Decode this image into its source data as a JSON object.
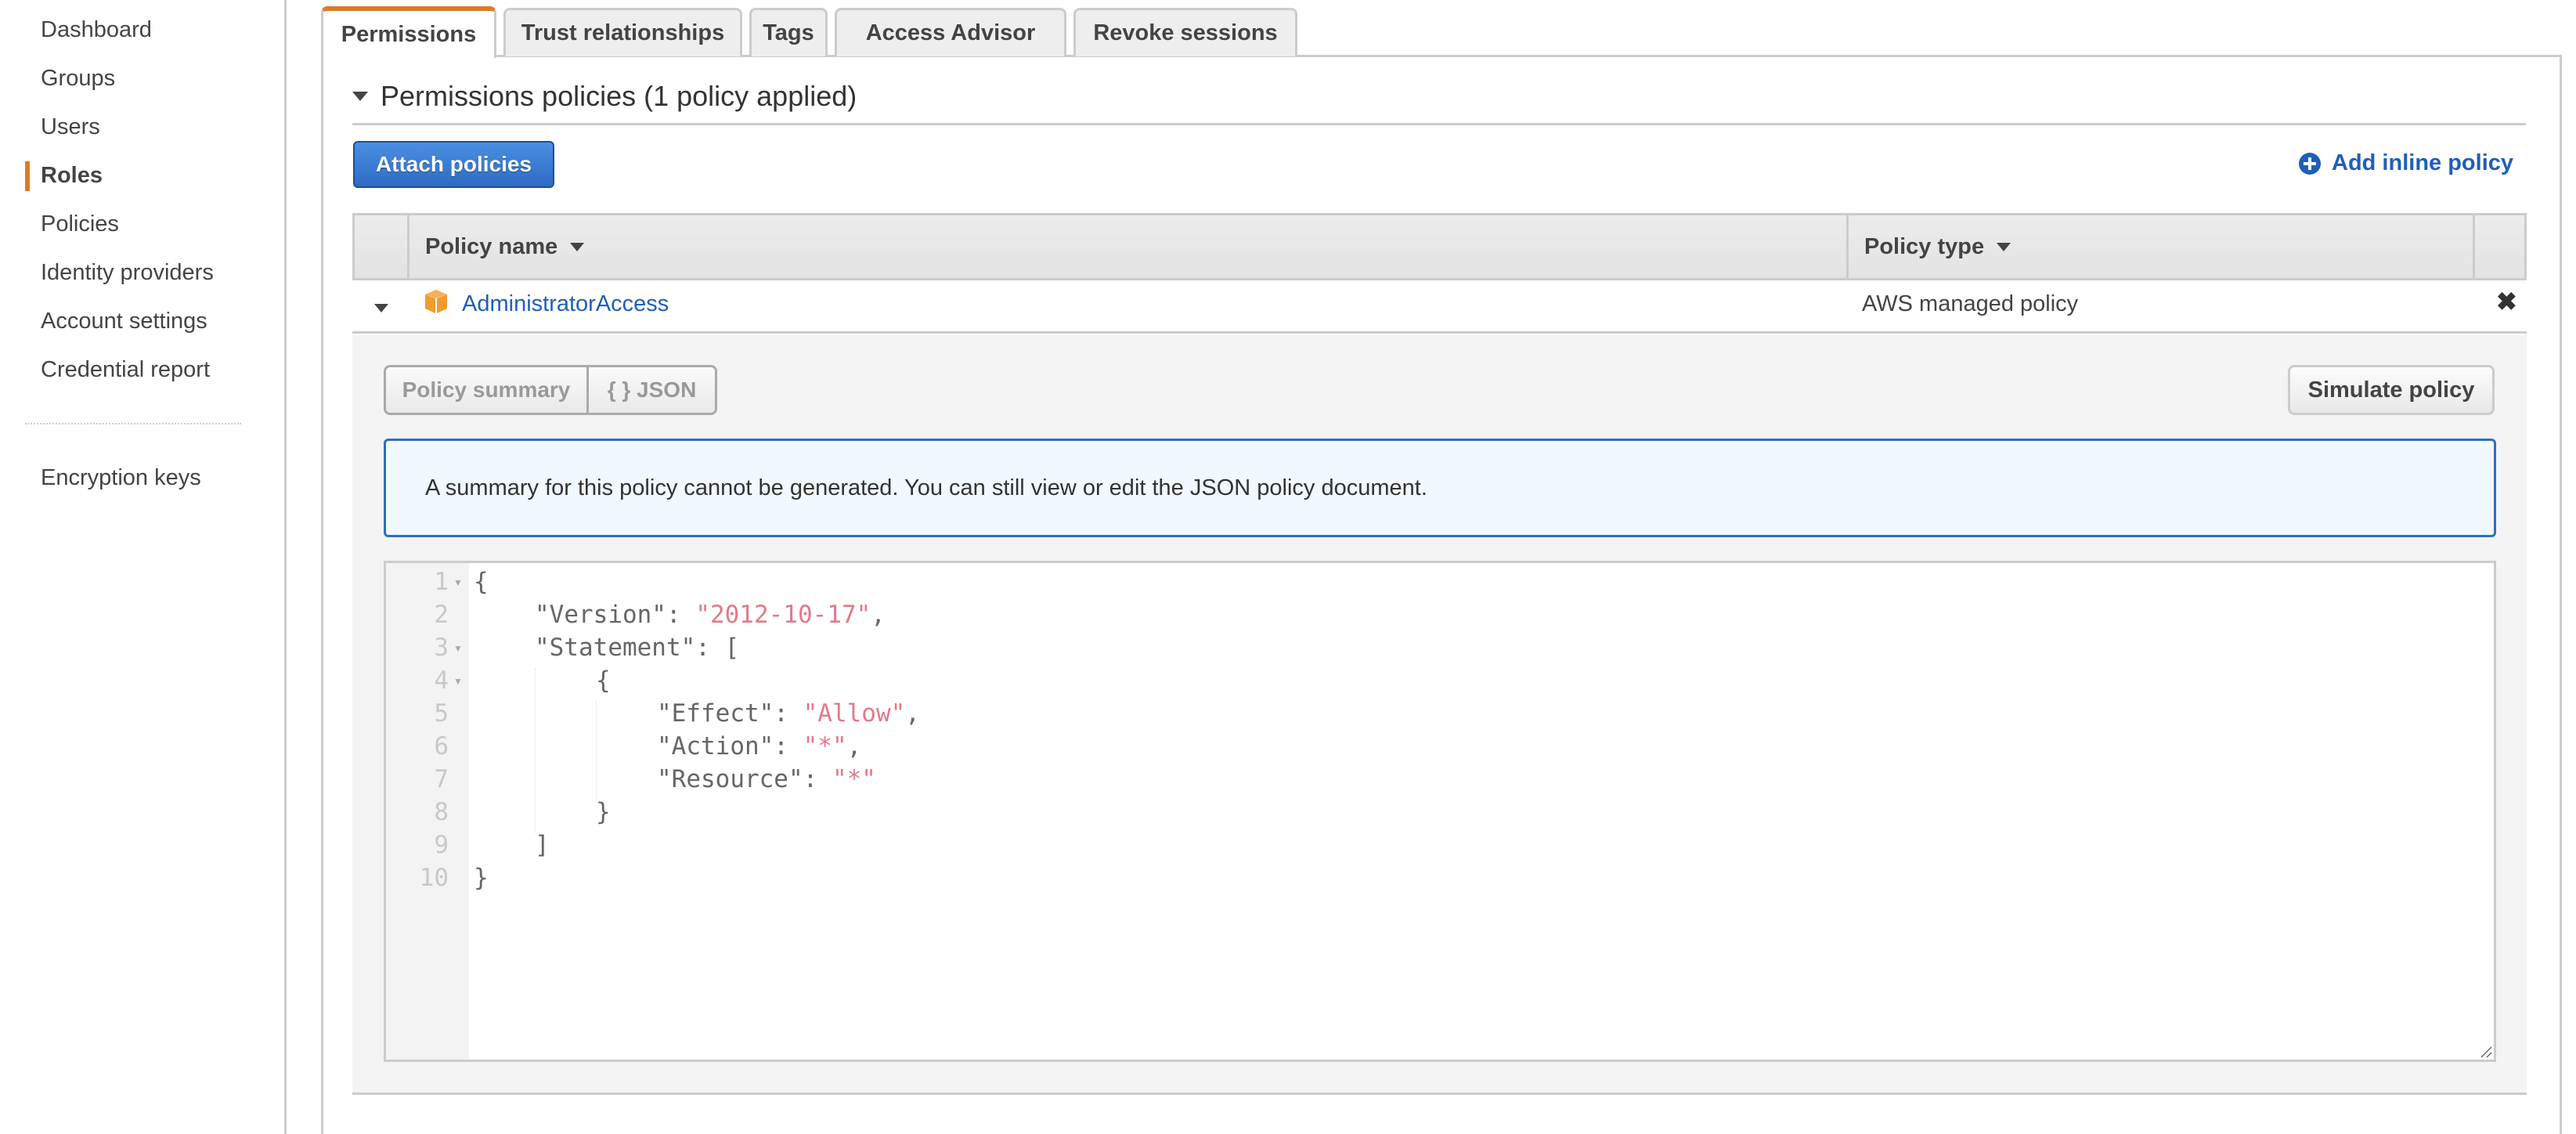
{
  "sidebar": {
    "items": [
      {
        "label": "Dashboard",
        "active": false
      },
      {
        "label": "Groups",
        "active": false
      },
      {
        "label": "Users",
        "active": false
      },
      {
        "label": "Roles",
        "active": true
      },
      {
        "label": "Policies",
        "active": false
      },
      {
        "label": "Identity providers",
        "active": false
      },
      {
        "label": "Account settings",
        "active": false
      },
      {
        "label": "Credential report",
        "active": false
      }
    ],
    "secondary_items": [
      {
        "label": "Encryption keys"
      }
    ],
    "accent_color": "#dd7b29"
  },
  "tabs": [
    {
      "label": "Permissions",
      "active": true
    },
    {
      "label": "Trust relationships",
      "active": false
    },
    {
      "label": "Tags",
      "active": false
    },
    {
      "label": "Access Advisor",
      "active": false
    },
    {
      "label": "Revoke sessions",
      "active": false
    }
  ],
  "permissions": {
    "section_title": "Permissions policies (1 policy applied)",
    "attach_button": "Attach policies",
    "add_inline_link": "Add inline policy",
    "table": {
      "columns": [
        "Policy name",
        "Policy type"
      ],
      "rows": [
        {
          "name": "AdministratorAccess",
          "type": "AWS managed policy",
          "icon": "aws-managed-policy-icon",
          "expanded": true
        }
      ]
    },
    "detail": {
      "view_toggle": [
        "Policy summary",
        "{ } JSON"
      ],
      "simulate_button": "Simulate policy",
      "alert_message": "A summary for this policy cannot be generated. You can still view or edit the JSON policy document.",
      "editor": {
        "line_numbers": [
          "1",
          "2",
          "3",
          "4",
          "5",
          "6",
          "7",
          "8",
          "9",
          "10"
        ],
        "lines": [
          {
            "indent": 0,
            "key": "",
            "text": "{",
            "value": "",
            "suffix": ""
          },
          {
            "indent": 1,
            "key": "\"Version\": ",
            "text": "",
            "value": "\"2012-10-17\"",
            "suffix": ","
          },
          {
            "indent": 1,
            "key": "\"Statement\": ",
            "text": "[",
            "value": "",
            "suffix": ""
          },
          {
            "indent": 2,
            "key": "",
            "text": "{",
            "value": "",
            "suffix": ""
          },
          {
            "indent": 3,
            "key": "\"Effect\": ",
            "text": "",
            "value": "\"Allow\"",
            "suffix": ","
          },
          {
            "indent": 3,
            "key": "\"Action\": ",
            "text": "",
            "value": "\"*\"",
            "suffix": ","
          },
          {
            "indent": 3,
            "key": "\"Resource\": ",
            "text": "",
            "value": "\"*\"",
            "suffix": ""
          },
          {
            "indent": 2,
            "key": "",
            "text": "}",
            "value": "",
            "suffix": ""
          },
          {
            "indent": 1,
            "key": "",
            "text": "]",
            "value": "",
            "suffix": ""
          },
          {
            "indent": 0,
            "key": "",
            "text": "}",
            "value": "",
            "suffix": ""
          }
        ],
        "foldable_lines": [
          "1",
          "3",
          "4"
        ]
      }
    }
  },
  "colors": {
    "link": "#1f5fb8",
    "primary_button": "#2d6bc2",
    "string_token": "#e07a8a",
    "alert_border": "#2e6fc0"
  }
}
